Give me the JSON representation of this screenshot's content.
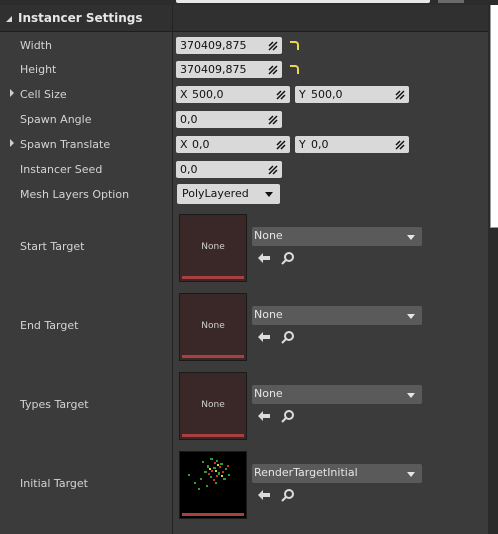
{
  "section": {
    "title": "Instancer Settings"
  },
  "rows": {
    "width": {
      "label": "Width",
      "value": "370409,875"
    },
    "height": {
      "label": "Height",
      "value": "370409,875"
    },
    "cell_size": {
      "label": "Cell Size",
      "x_axis": "X",
      "x": "500,0",
      "y_axis": "Y",
      "y": "500,0"
    },
    "spawn_angle": {
      "label": "Spawn Angle",
      "value": "0,0"
    },
    "spawn_translate": {
      "label": "Spawn Translate",
      "x_axis": "X",
      "x": "0,0",
      "y_axis": "Y",
      "y": "0,0"
    },
    "instancer_seed": {
      "label": "Instancer Seed",
      "value": "0,0"
    },
    "mesh_layers_option": {
      "label": "Mesh Layers Option",
      "value": "PolyLayered"
    }
  },
  "targets": [
    {
      "label": "Start Target",
      "thumbnail_text": "None",
      "asset": "None"
    },
    {
      "label": "End Target",
      "thumbnail_text": "None",
      "asset": "None"
    },
    {
      "label": "Types Target",
      "thumbnail_text": "None",
      "asset": "None"
    },
    {
      "label": "Initial Target",
      "thumbnail_text": "",
      "asset": "RenderTargetInitial"
    }
  ],
  "icons": {
    "reset": "reset-to-default-icon",
    "drag": "drag-handle-icon",
    "use_selected": "use-selected-arrow-icon",
    "browse": "browse-magnifier-icon"
  },
  "colors": {
    "accent_reset": "#e8d84a",
    "thumb_bar": "#a84040"
  }
}
